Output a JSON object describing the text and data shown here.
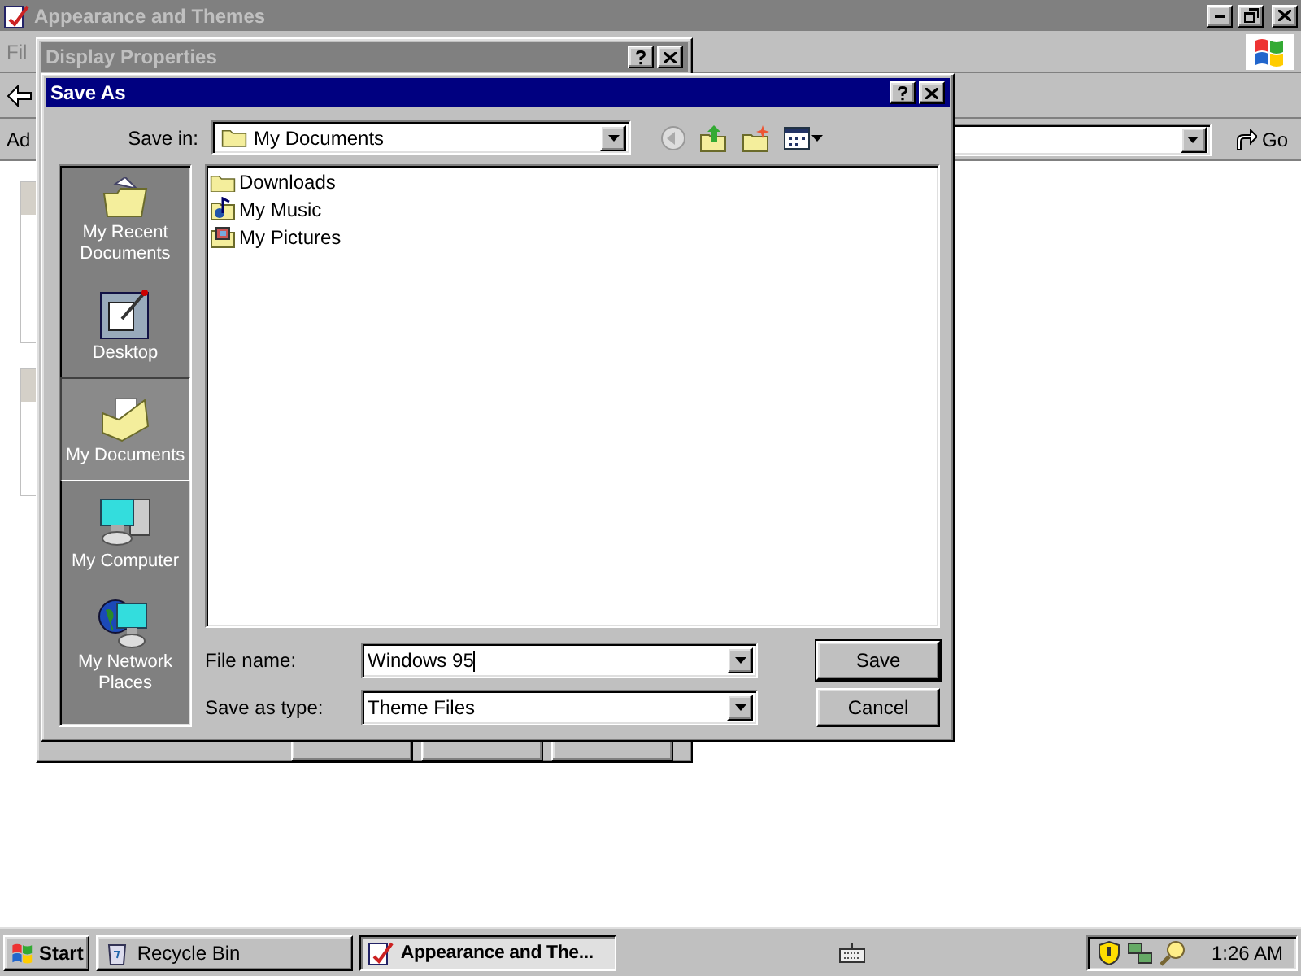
{
  "background_window": {
    "title": "Appearance and Themes",
    "menu_first": "Fil",
    "address_label": "Ad",
    "go_button": "Go"
  },
  "display_properties": {
    "title": "Display Properties"
  },
  "save_as": {
    "title": "Save As",
    "save_in_label": "Save in:",
    "save_in_value": "My Documents",
    "places": [
      {
        "label": "My Recent Documents",
        "kind": "recent",
        "selected": false
      },
      {
        "label": "Desktop",
        "kind": "desktop",
        "selected": false
      },
      {
        "label": "My Documents",
        "kind": "documents",
        "selected": true
      },
      {
        "label": "My Computer",
        "kind": "computer",
        "selected": false
      },
      {
        "label": "My Network Places",
        "kind": "network",
        "selected": false
      }
    ],
    "files": [
      {
        "name": "Downloads",
        "kind": "folder"
      },
      {
        "name": "My Music",
        "kind": "music"
      },
      {
        "name": "My Pictures",
        "kind": "pictures"
      }
    ],
    "file_name_label": "File name:",
    "file_name_value": "Windows 95",
    "type_label": "Save as type:",
    "type_value": "Theme Files",
    "buttons": [
      "Save",
      "Cancel"
    ]
  },
  "taskbar": {
    "start": "Start",
    "tasks": [
      {
        "label": "Recycle Bin",
        "kind": "recycle",
        "selected": false
      },
      {
        "label": "Appearance and The...",
        "kind": "appearance",
        "selected": true
      }
    ],
    "clock": "1:26 AM"
  }
}
